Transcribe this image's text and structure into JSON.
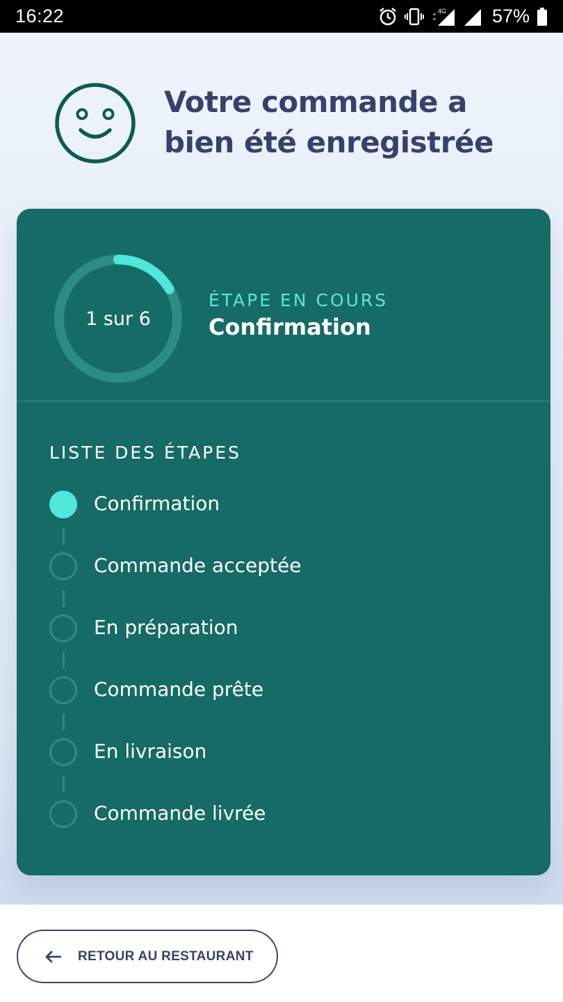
{
  "status_bar": {
    "time": "16:22",
    "network": "4G",
    "battery": "57%",
    "icons": [
      "alarm-icon",
      "vibrate-icon",
      "signal-icon",
      "battery-icon"
    ]
  },
  "header": {
    "icon": "smiley-icon",
    "title": "Votre commande a bien été enregistrée"
  },
  "progress": {
    "current": 1,
    "total": 6,
    "label": "1 sur 6",
    "caption": "ÉTAPE EN COURS",
    "current_step": "Confirmation"
  },
  "steps": {
    "title": "LISTE DES ÉTAPES",
    "items": [
      {
        "label": "Confirmation",
        "active": true
      },
      {
        "label": "Commande acceptée",
        "active": false
      },
      {
        "label": "En préparation",
        "active": false
      },
      {
        "label": "Commande prête",
        "active": false
      },
      {
        "label": "En livraison",
        "active": false
      },
      {
        "label": "Commande livrée",
        "active": false
      }
    ]
  },
  "footer": {
    "back_icon": "arrow-left-icon",
    "back_label": "RETOUR AU RESTAURANT"
  },
  "colors": {
    "card": "#166b66",
    "accent": "#4fe6dc",
    "title": "#38416b",
    "ring_track": "#2d8c84"
  }
}
